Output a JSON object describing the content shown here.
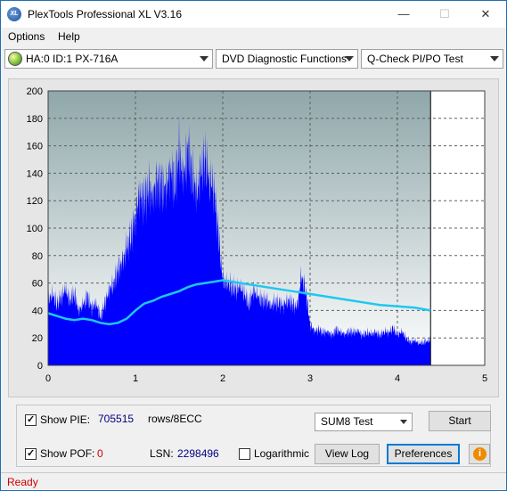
{
  "window": {
    "title": "PlexTools Professional XL V3.16",
    "icon_text": "XL",
    "minimize_glyph": "—",
    "maximize_glyph": "☐",
    "close_glyph": "✕"
  },
  "menu": {
    "items": [
      {
        "label": "Options"
      },
      {
        "label": "Help"
      }
    ]
  },
  "toolbar": {
    "drive": "HA:0 ID:1  PX-716A",
    "function": "DVD Diagnostic Functions",
    "test": "Q-Check PI/PO Test"
  },
  "chart_data": {
    "type": "area",
    "x_ticks": [
      "0",
      "1",
      "2",
      "3",
      "4",
      "5"
    ],
    "y_ticks": [
      "0",
      "20",
      "40",
      "60",
      "80",
      "100",
      "120",
      "140",
      "160",
      "180",
      "200"
    ],
    "xlim": [
      0,
      5
    ],
    "ylim": [
      0,
      200
    ],
    "grid": true,
    "data_end_x": 4.38,
    "colors": {
      "bars": "#0000ff",
      "avg_line": "#1ec8f0",
      "bg_top": "#8fa7aa",
      "bg_bottom": "#ffffff"
    },
    "series": [
      {
        "kind": "bars",
        "points": [
          [
            0.0,
            48
          ],
          [
            0.05,
            52
          ],
          [
            0.1,
            45
          ],
          [
            0.15,
            50
          ],
          [
            0.2,
            55
          ],
          [
            0.25,
            47
          ],
          [
            0.3,
            53
          ],
          [
            0.35,
            40
          ],
          [
            0.4,
            44
          ],
          [
            0.45,
            50
          ],
          [
            0.5,
            42
          ],
          [
            0.55,
            46
          ],
          [
            0.6,
            35
          ],
          [
            0.65,
            45
          ],
          [
            0.7,
            55
          ],
          [
            0.75,
            60
          ],
          [
            0.8,
            70
          ],
          [
            0.85,
            75
          ],
          [
            0.9,
            85
          ],
          [
            0.95,
            95
          ],
          [
            1.0,
            110
          ],
          [
            1.05,
            125
          ],
          [
            1.1,
            120
          ],
          [
            1.15,
            130
          ],
          [
            1.2,
            125
          ],
          [
            1.25,
            135
          ],
          [
            1.3,
            130
          ],
          [
            1.35,
            128
          ],
          [
            1.4,
            145
          ],
          [
            1.45,
            132
          ],
          [
            1.5,
            155
          ],
          [
            1.55,
            135
          ],
          [
            1.6,
            158
          ],
          [
            1.65,
            140
          ],
          [
            1.7,
            125
          ],
          [
            1.75,
            140
          ],
          [
            1.8,
            150
          ],
          [
            1.85,
            135
          ],
          [
            1.9,
            130
          ],
          [
            1.95,
            95
          ],
          [
            2.0,
            62
          ],
          [
            2.05,
            60
          ],
          [
            2.1,
            58
          ],
          [
            2.15,
            55
          ],
          [
            2.2,
            57
          ],
          [
            2.25,
            52
          ],
          [
            2.3,
            45
          ],
          [
            2.35,
            55
          ],
          [
            2.4,
            50
          ],
          [
            2.45,
            47
          ],
          [
            2.5,
            48
          ],
          [
            2.55,
            44
          ],
          [
            2.6,
            46
          ],
          [
            2.65,
            45
          ],
          [
            2.7,
            44
          ],
          [
            2.75,
            48
          ],
          [
            2.8,
            45
          ],
          [
            2.85,
            42
          ],
          [
            2.9,
            65
          ],
          [
            2.95,
            55
          ],
          [
            3.0,
            30
          ],
          [
            3.05,
            25
          ],
          [
            3.1,
            26
          ],
          [
            3.15,
            24
          ],
          [
            3.2,
            25
          ],
          [
            3.25,
            22
          ],
          [
            3.3,
            26
          ],
          [
            3.35,
            24
          ],
          [
            3.4,
            23
          ],
          [
            3.45,
            25
          ],
          [
            3.5,
            24
          ],
          [
            3.55,
            25
          ],
          [
            3.6,
            22
          ],
          [
            3.65,
            24
          ],
          [
            3.7,
            23
          ],
          [
            3.75,
            24
          ],
          [
            3.8,
            22
          ],
          [
            3.85,
            25
          ],
          [
            3.9,
            24
          ],
          [
            3.95,
            27
          ],
          [
            4.0,
            22
          ],
          [
            4.05,
            25
          ],
          [
            4.1,
            20
          ],
          [
            4.15,
            17
          ],
          [
            4.2,
            18
          ],
          [
            4.25,
            16
          ],
          [
            4.3,
            17
          ],
          [
            4.35,
            18
          ]
        ]
      },
      {
        "kind": "line",
        "points": [
          [
            0.0,
            38
          ],
          [
            0.1,
            36
          ],
          [
            0.2,
            34
          ],
          [
            0.3,
            33
          ],
          [
            0.4,
            34
          ],
          [
            0.5,
            33
          ],
          [
            0.6,
            31
          ],
          [
            0.7,
            30
          ],
          [
            0.8,
            31
          ],
          [
            0.9,
            34
          ],
          [
            1.0,
            40
          ],
          [
            1.1,
            45
          ],
          [
            1.2,
            47
          ],
          [
            1.3,
            50
          ],
          [
            1.4,
            52
          ],
          [
            1.5,
            54
          ],
          [
            1.6,
            57
          ],
          [
            1.7,
            59
          ],
          [
            1.8,
            60
          ],
          [
            1.9,
            61
          ],
          [
            2.0,
            62
          ],
          [
            2.2,
            60
          ],
          [
            2.4,
            58
          ],
          [
            2.6,
            56
          ],
          [
            2.8,
            54
          ],
          [
            3.0,
            52
          ],
          [
            3.2,
            50
          ],
          [
            3.4,
            48
          ],
          [
            3.6,
            46
          ],
          [
            3.8,
            44
          ],
          [
            4.0,
            43
          ],
          [
            4.2,
            42
          ],
          [
            4.38,
            40
          ]
        ]
      }
    ]
  },
  "controls": {
    "show_pie_label": "Show PIE:",
    "pie_value": "705515",
    "rows_label": "rows/8ECC",
    "show_pof_label": "Show POF:",
    "pof_value": "0",
    "lsn_label": "LSN:",
    "lsn_value": "2298496",
    "logarithmic_label": "Logarithmic",
    "sum_select": "SUM8 Test",
    "start_label": "Start",
    "view_log_label": "View Log",
    "preferences_label": "Preferences",
    "info_glyph": "i"
  },
  "status": {
    "text": "Ready"
  }
}
